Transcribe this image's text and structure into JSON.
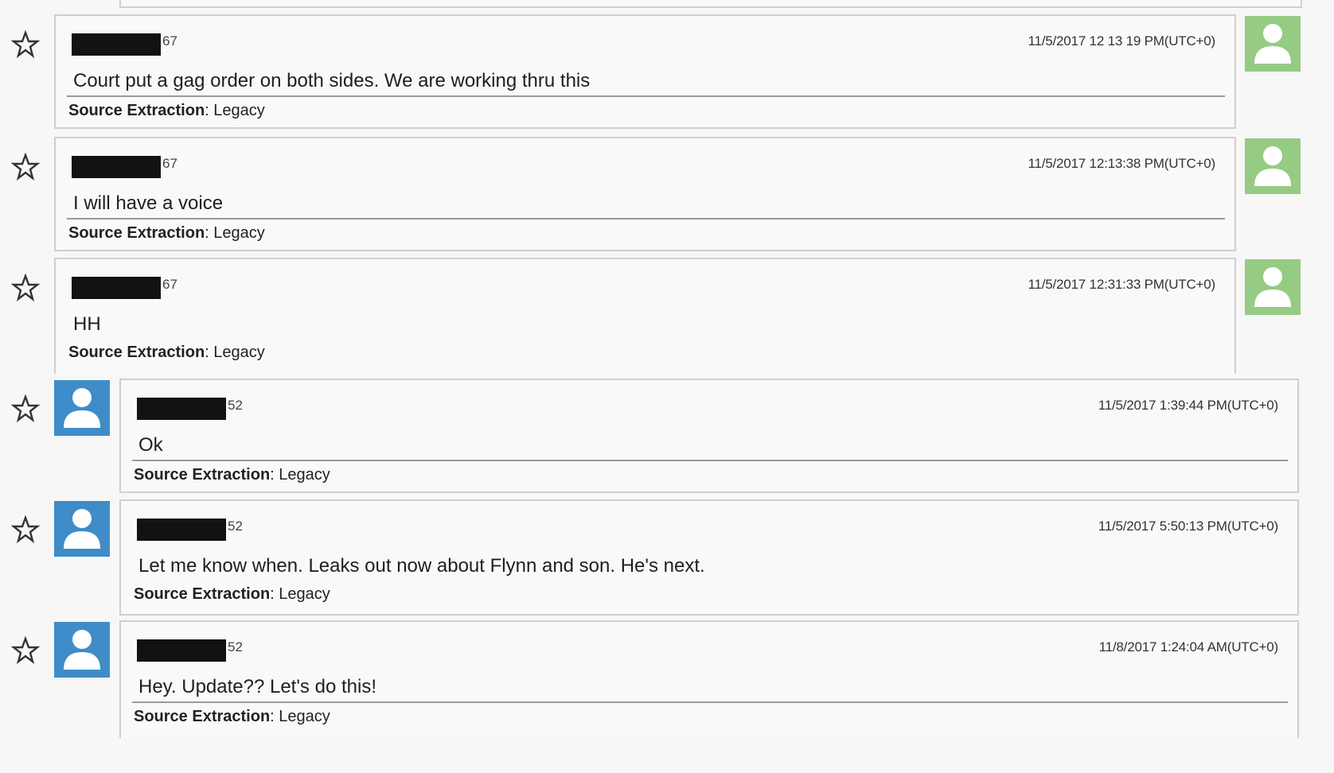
{
  "source_label": "Source Extraction",
  "source_value": "Legacy",
  "colors": {
    "outgoing_avatar": "#96cb84",
    "incoming_avatar": "#3f8cc8",
    "redaction": "#121212"
  },
  "messages": [
    {
      "direction": "right",
      "sender_suffix": "67",
      "timestamp": "11/5/2017 12 13 19 PM(UTC+0)",
      "text": "Court put a gag order on both sides. We are working thru this"
    },
    {
      "direction": "right",
      "sender_suffix": "67",
      "timestamp": "11/5/2017 12:13:38 PM(UTC+0)",
      "text": "I will have a voice"
    },
    {
      "direction": "right",
      "sender_suffix": "67",
      "timestamp": "11/5/2017 12:31:33 PM(UTC+0)",
      "text": "HH"
    },
    {
      "direction": "left",
      "sender_suffix": "52",
      "timestamp": "11/5/2017 1:39:44 PM(UTC+0)",
      "text": "Ok"
    },
    {
      "direction": "left",
      "sender_suffix": "52",
      "timestamp": "11/5/2017 5:50:13 PM(UTC+0)",
      "text": "Let me know when. Leaks out now about Flynn and son. He's next."
    },
    {
      "direction": "left",
      "sender_suffix": "52",
      "timestamp": "11/8/2017 1:24:04 AM(UTC+0)",
      "text": "Hey. Update?? Let's do this!"
    }
  ]
}
